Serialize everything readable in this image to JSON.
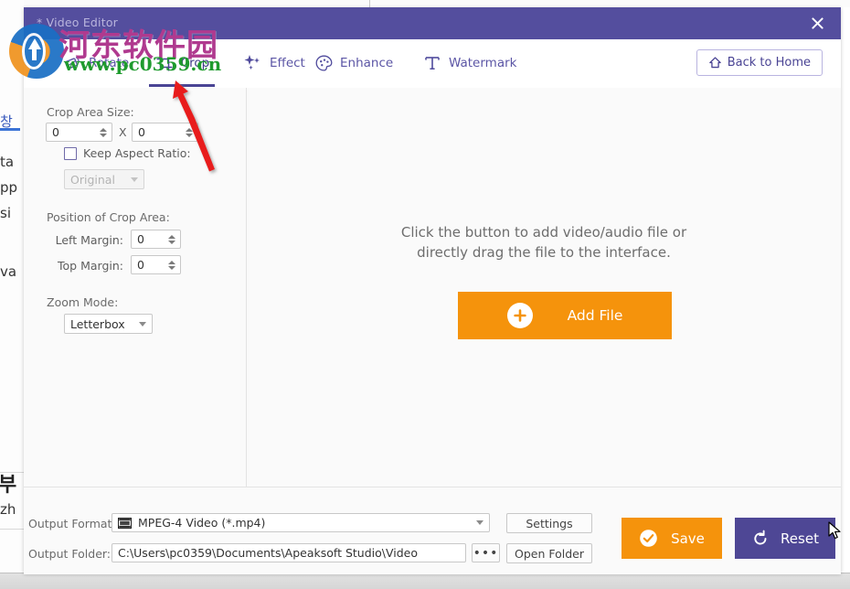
{
  "background_window": {
    "fragments": [
      "창",
      "ta",
      "pp",
      "si",
      "va",
      "zh"
    ],
    "cjk_fragment": "부"
  },
  "window": {
    "title": "* Video Editor",
    "close_icon": "close-icon"
  },
  "toolbar": {
    "tabs": [
      {
        "label": "Rotate",
        "icon": "rotate-icon",
        "active": false
      },
      {
        "label": "Crop",
        "icon": "crop-icon",
        "active": true
      },
      {
        "label": "Effect",
        "icon": "sparkle-icon",
        "active": false
      },
      {
        "label": "Enhance",
        "icon": "enhance-icon",
        "active": false
      },
      {
        "label": "Watermark",
        "icon": "text-t-icon",
        "active": false
      }
    ],
    "back_home_label": "Back to Home",
    "back_home_icon": "home-icon"
  },
  "crop_panel": {
    "crop_area_size_label": "Crop Area Size:",
    "width_value": "0",
    "x_separator": "X",
    "height_value": "0",
    "keep_aspect_ratio_label": "Keep Aspect Ratio:",
    "keep_aspect_ratio_checked": false,
    "aspect_ratio_value": "Original",
    "aspect_ratio_disabled": true,
    "position_label": "Position of Crop Area:",
    "left_margin_label": "Left Margin:",
    "left_margin_value": "0",
    "top_margin_label": "Top Margin:",
    "top_margin_value": "0",
    "zoom_mode_label": "Zoom Mode:",
    "zoom_mode_value": "Letterbox"
  },
  "preview": {
    "hint_line1": "Click the button to add video/audio file or",
    "hint_line2": "directly drag the file to the interface.",
    "add_file_label": "Add File",
    "add_file_icon": "plus-icon"
  },
  "bottom_bar": {
    "output_format_label": "Output Format:",
    "output_format_value": "MPEG-4 Video (*.mp4)",
    "output_format_icon": "film-icon",
    "output_folder_label": "Output Folder:",
    "output_folder_value": "C:\\Users\\pc0359\\Documents\\Apeaksoft Studio\\Video",
    "browse_label": "•••",
    "settings_label": "Settings",
    "open_folder_label": "Open Folder",
    "save_label": "Save",
    "save_icon": "check-circle-icon",
    "reset_label": "Reset",
    "reset_icon": "refresh-icon"
  },
  "watermark": {
    "site_name_cn": "河东软件园",
    "site_url": "www.pc0359.cn"
  },
  "colors": {
    "title_bar": "#544e9e",
    "accent_purple": "#4a4494",
    "accent_orange": "#f5930c",
    "reset_purple": "#4e4795",
    "panel_bg": "#fafafa",
    "annotation_red": "#e81f1f"
  }
}
